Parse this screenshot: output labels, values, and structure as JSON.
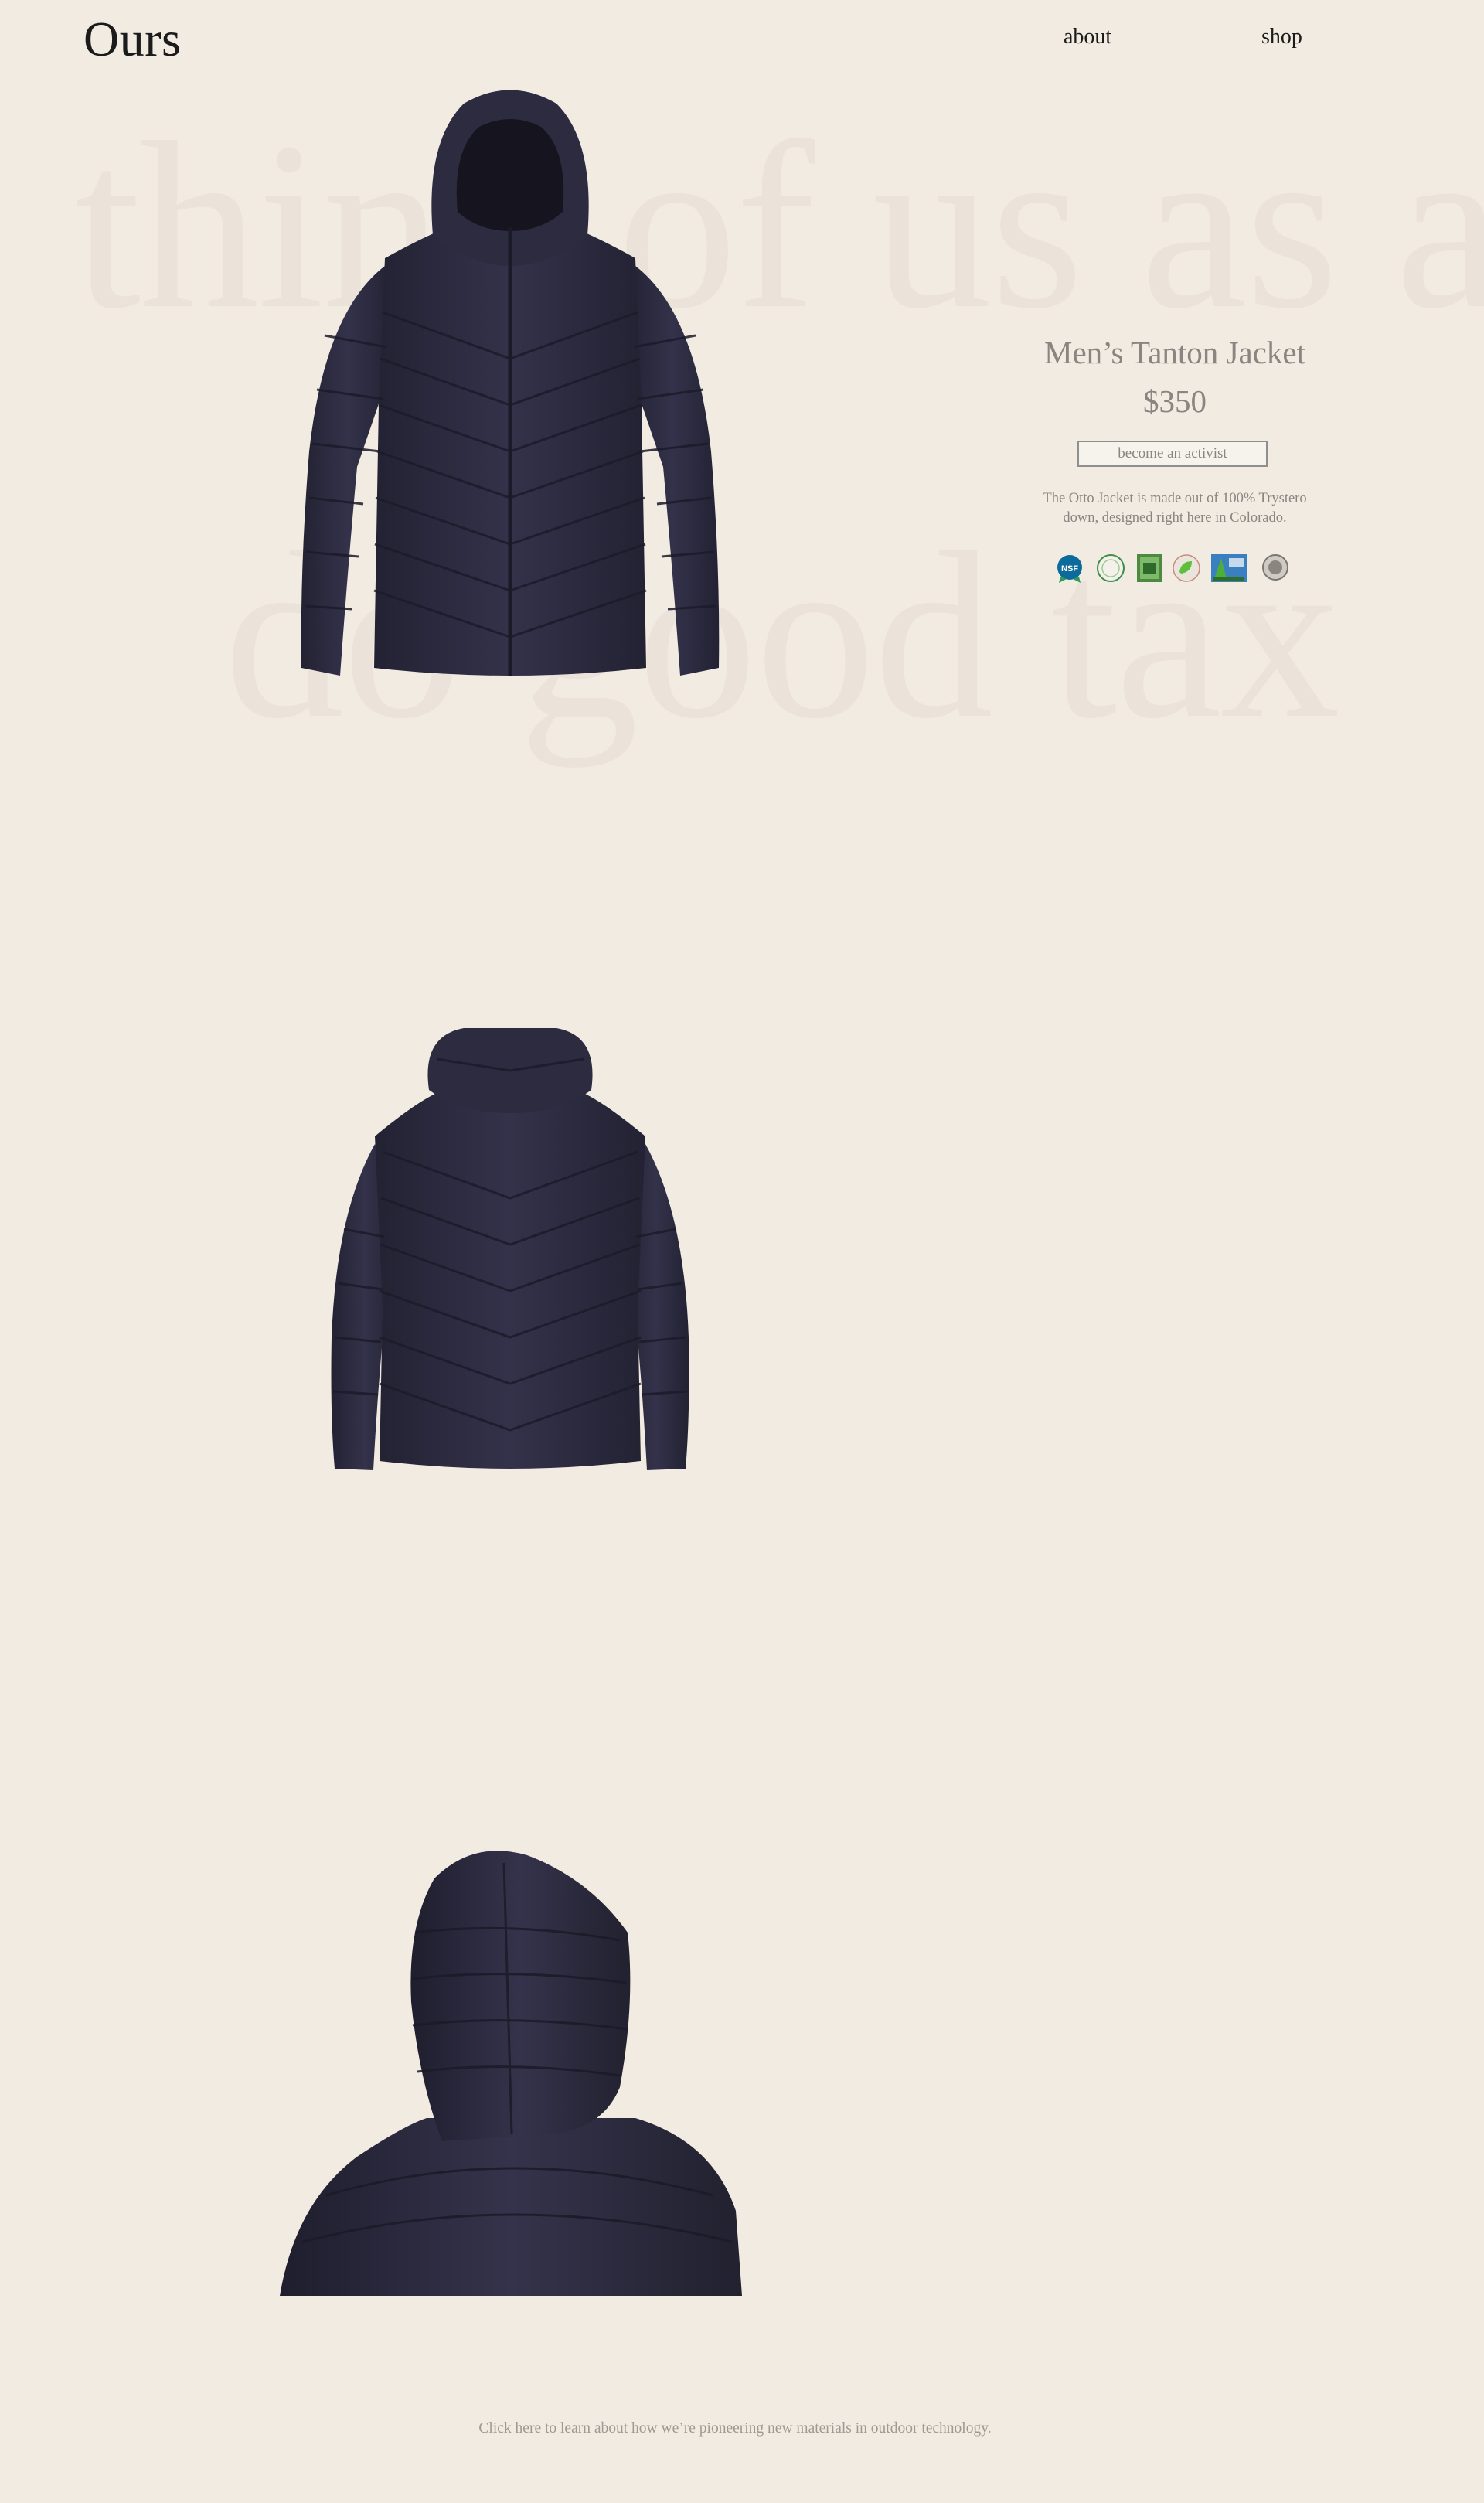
{
  "header": {
    "logo": "Ours",
    "nav": [
      {
        "label": "about"
      },
      {
        "label": "shop"
      }
    ]
  },
  "background_text": {
    "line1": "think of us as a",
    "line2": "do good tax"
  },
  "product": {
    "title": "Men’s Tanton Jacket",
    "price": "$350",
    "cta_label": "become an activist",
    "description_line1": "The Otto Jacket is made out of 100% Trystero",
    "description_line2": "down,  designed right here in Colorado.",
    "jacket_color": "#2e2d41",
    "badges": [
      {
        "name": "nsf-badge-icon",
        "text": "NSF"
      },
      {
        "name": "green-seal-badge-icon"
      },
      {
        "name": "recycled-badge-icon"
      },
      {
        "name": "leaf-cert-badge-icon"
      },
      {
        "name": "non-gmo-badge-icon"
      },
      {
        "name": "gray-seal-badge-icon"
      }
    ]
  },
  "images": [
    {
      "name": "jacket-front-image"
    },
    {
      "name": "jacket-back-image"
    },
    {
      "name": "jacket-hood-image"
    }
  ],
  "footer": {
    "link_label": "Click here to learn about how we’re pioneering new materials in outdoor technology."
  }
}
